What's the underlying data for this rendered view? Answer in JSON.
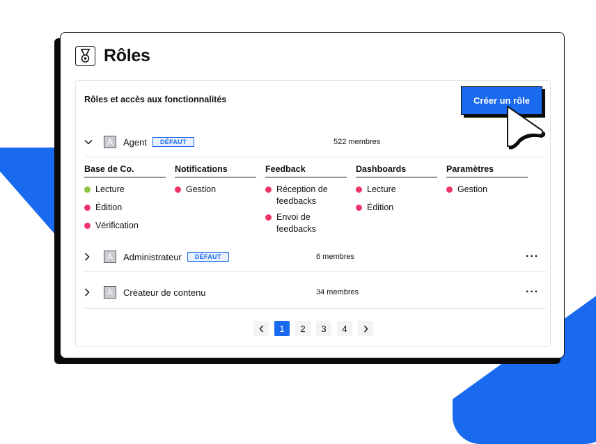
{
  "page": {
    "title": "Rôles"
  },
  "panel": {
    "header": "Rôles et accès aux fonctionnalités",
    "create_label": "Créer un rôle"
  },
  "roles": [
    {
      "name": "Agent",
      "badge": "DÉFAUT",
      "members": "522 membres",
      "expanded": true
    },
    {
      "name": "Administrateur",
      "badge": "DÉFAUT",
      "members": "6 membres",
      "expanded": false
    },
    {
      "name": "Créateur de contenu",
      "members": "34 membres",
      "expanded": false
    }
  ],
  "avatar_letter": "A",
  "permissions": [
    {
      "title": "Base de Co.",
      "items": [
        {
          "label": "Lecture",
          "color": "#8cc63f"
        },
        {
          "label": "Édition",
          "color": "#f0346a"
        },
        {
          "label": "Vérification",
          "color": "#f0346a"
        }
      ]
    },
    {
      "title": "Notifications",
      "items": [
        {
          "label": "Gestion",
          "color": "#f0346a"
        }
      ]
    },
    {
      "title": "Feedback",
      "items": [
        {
          "label": "Réception de feedbacks",
          "color": "#f0346a"
        },
        {
          "label": "Envoi de feedbacks",
          "color": "#f0346a"
        }
      ]
    },
    {
      "title": "Dashboards",
      "items": [
        {
          "label": "Lecture",
          "color": "#f0346a"
        },
        {
          "label": "Édition",
          "color": "#f0346a"
        }
      ]
    },
    {
      "title": "Paramètres",
      "items": [
        {
          "label": "Gestion",
          "color": "#f0346a"
        }
      ]
    }
  ],
  "pagination": {
    "pages": [
      "1",
      "2",
      "3",
      "4"
    ],
    "current": "1"
  },
  "colors": {
    "accent": "#1a6af0",
    "allowed": "#8cc63f",
    "denied": "#f0346a"
  }
}
